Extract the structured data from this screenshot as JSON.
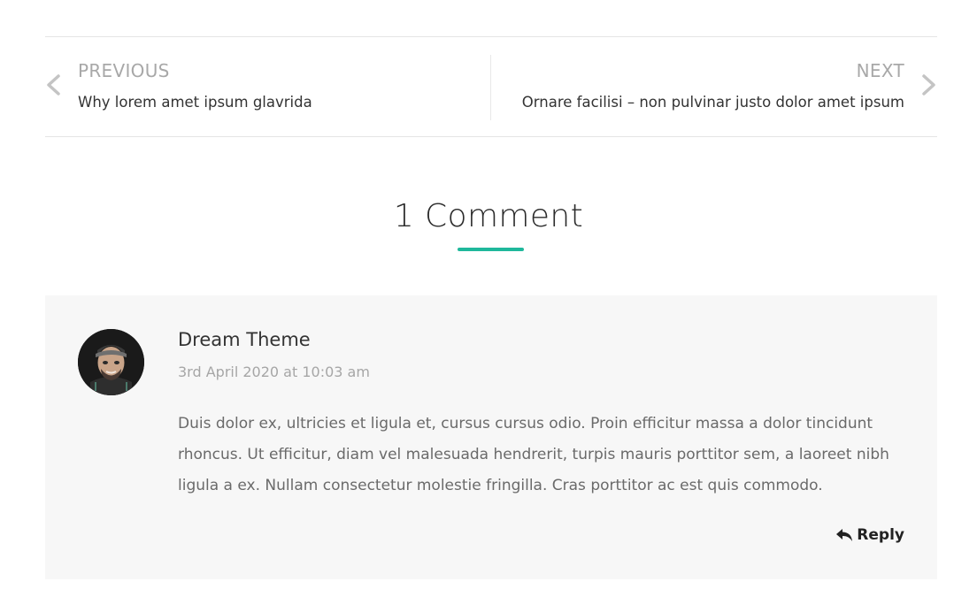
{
  "post_navigation": {
    "previous": {
      "kicker": "PREVIOUS",
      "title": "Why lorem amet ipsum glavrida"
    },
    "next": {
      "kicker": "NEXT",
      "title": "Ornare facilisi – non pulvinar justo dolor amet ipsum"
    }
  },
  "comments": {
    "heading": "1 Comment",
    "accent_color": "#1fb89b",
    "items": [
      {
        "author": "Dream Theme",
        "date": "3rd April 2020 at 10:03 am",
        "text": "Duis dolor ex, ultricies et ligula et, cursus cursus odio. Proin efficitur massa a dolor tincidunt rhoncus. Ut efficitur, diam vel malesuada hendrerit, turpis mauris porttitor sem, a laoreet nibh ligula a ex. Nullam consectetur molestie fringilla. Cras porttitor ac est quis commodo.",
        "reply_label": "Reply"
      }
    ]
  },
  "icons": {
    "prev": "chevron-left-icon",
    "next": "chevron-right-icon",
    "reply": "reply-arrow-icon"
  }
}
